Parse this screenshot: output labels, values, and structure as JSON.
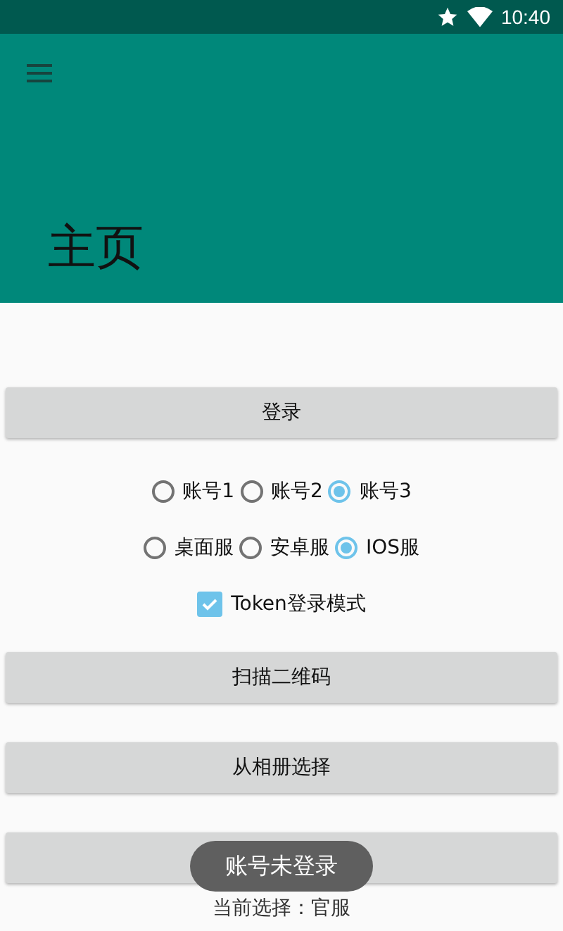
{
  "status_bar": {
    "time": "10:40"
  },
  "app_bar": {
    "title": "主页"
  },
  "login_button": {
    "label": "登录"
  },
  "accounts": [
    {
      "label": "账号1",
      "selected": false
    },
    {
      "label": "账号2",
      "selected": false
    },
    {
      "label": "账号3",
      "selected": true
    }
  ],
  "servers": [
    {
      "label": "桌面服",
      "selected": false
    },
    {
      "label": "安卓服",
      "selected": false
    },
    {
      "label": "IOS服",
      "selected": true
    }
  ],
  "token_mode": {
    "label": "Token登录模式",
    "checked": true
  },
  "buttons": [
    {
      "label": "扫描二维码"
    },
    {
      "label": "从相册选择"
    }
  ],
  "current_selection": "当前选择：官服",
  "toast": "账号未登录"
}
